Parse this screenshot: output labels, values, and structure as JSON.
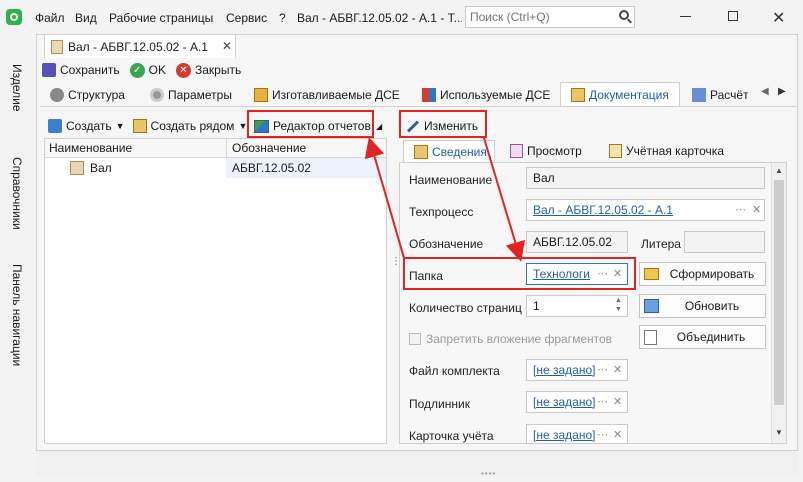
{
  "title_bar": {
    "menu": [
      "Файл",
      "Вид",
      "Рабочие страницы",
      "Сервис",
      "?"
    ],
    "doc_title": "Вал - АБВГ.12.05.02 - А.1 - Т...",
    "search_placeholder": "Поиск (Ctrl+Q)"
  },
  "side_panel": [
    "Изделие",
    "Справочники",
    "Панель навигации"
  ],
  "doc_tab": {
    "label": "Вал - АБВГ.12.05.02 - А.1"
  },
  "toolbar": {
    "save": "Сохранить",
    "ok": "OK",
    "close": "Закрыть"
  },
  "tabs": [
    "Структура",
    "Параметры",
    "Изготавливаемые ДСЕ",
    "Используемые ДСЕ",
    "Документация",
    "Расчёт"
  ],
  "left_toolbar": {
    "create": "Создать",
    "create_near": "Создать рядом",
    "report_editor": "Редактор отчетов"
  },
  "table": {
    "headers": [
      "Наименование",
      "Обозначение"
    ],
    "rows": [
      {
        "name": "Вал",
        "designation": "АБВГ.12.05.02"
      }
    ]
  },
  "right_toolbar": {
    "edit": "Изменить"
  },
  "subtabs": [
    "Сведения",
    "Просмотр",
    "Учётная карточка"
  ],
  "form": {
    "name_label": "Наименование",
    "name_value": "Вал",
    "process_label": "Техпроцесс",
    "process_value": "Вал - АБВГ.12.05.02 - А.1",
    "designation_label": "Обозначение",
    "designation_value": "АБВГ.12.05.02",
    "letter_label": "Литера",
    "letter_value": "",
    "folder_label": "Папка",
    "folder_value": "Технологи",
    "pages_label": "Количество страниц",
    "pages_value": "1",
    "forbid_fragments": "Запретить вложение фрагментов",
    "kit_file_label": "Файл комплекта",
    "kit_file_value": "[не задано]",
    "original_label": "Подлинник",
    "original_value": "[не задано]",
    "card_label": "Карточка учёта",
    "card_value": "[не задано]"
  },
  "actions": {
    "form_btn": "Сформировать",
    "refresh_btn": "Обновить",
    "merge_btn": "Объединить"
  },
  "colors": {
    "accent": "#2b78c5",
    "highlight": "#e32222",
    "selection": "#cde4f7"
  }
}
